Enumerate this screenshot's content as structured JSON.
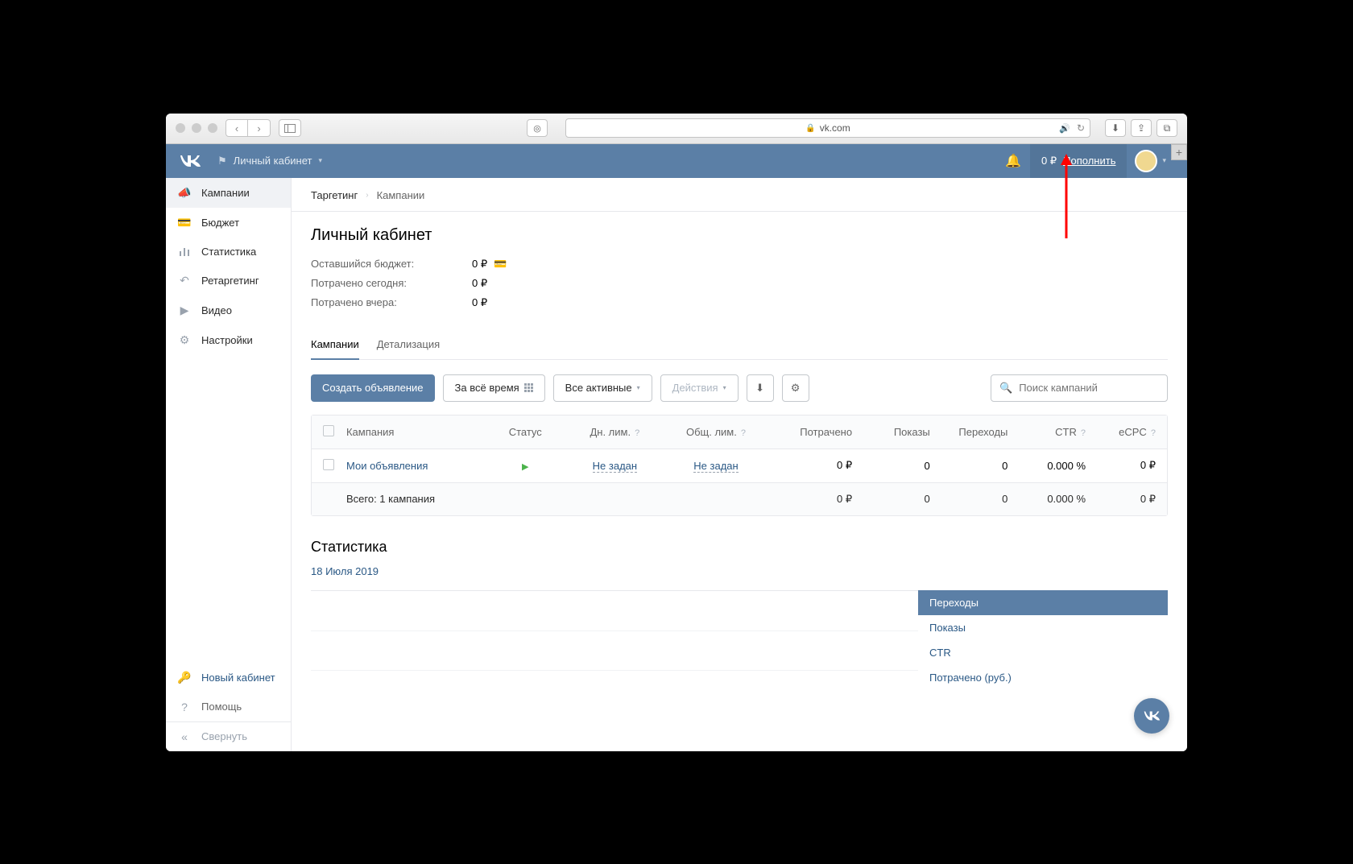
{
  "safari": {
    "url": "vk.com"
  },
  "header": {
    "cabinet": "Личный кабинет",
    "balance": "0 ₽",
    "topup": "Пополнить"
  },
  "sidebar": {
    "items": [
      {
        "label": "Кампании"
      },
      {
        "label": "Бюджет"
      },
      {
        "label": "Статистика"
      },
      {
        "label": "Ретаргетинг"
      },
      {
        "label": "Видео"
      },
      {
        "label": "Настройки"
      }
    ],
    "new_cabinet": "Новый кабинет",
    "help": "Помощь",
    "collapse": "Свернуть"
  },
  "breadcrumb": {
    "root": "Таргетинг",
    "current": "Кампании"
  },
  "page": {
    "title": "Личный кабинет",
    "budget": {
      "remaining_label": "Оставшийся бюджет:",
      "remaining_value": "0 ₽",
      "spent_today_label": "Потрачено сегодня:",
      "spent_today_value": "0 ₽",
      "spent_yesterday_label": "Потрачено вчера:",
      "spent_yesterday_value": "0 ₽"
    },
    "tabs": {
      "campaigns": "Кампании",
      "details": "Детализация"
    },
    "toolbar": {
      "create": "Создать объявление",
      "period": "За всё время",
      "filter": "Все активные",
      "actions": "Действия",
      "search_placeholder": "Поиск кампаний"
    },
    "table": {
      "headers": {
        "campaign": "Кампания",
        "status": "Статус",
        "daily_limit": "Дн. лим.",
        "total_limit": "Общ. лим.",
        "spent": "Потрачено",
        "impressions": "Показы",
        "clicks": "Переходы",
        "ctr": "CTR",
        "ecpc": "eCPC"
      },
      "rows": [
        {
          "name": "Мои объявления",
          "daily_limit": "Не задан",
          "total_limit": "Не задан",
          "spent": "0 ₽",
          "impressions": "0",
          "clicks": "0",
          "ctr": "0.000 %",
          "ecpc": "0 ₽"
        }
      ],
      "footer": {
        "label": "Всего: 1 кампания",
        "spent": "0 ₽",
        "impressions": "0",
        "clicks": "0",
        "ctr": "0.000 %",
        "ecpc": "0 ₽"
      }
    },
    "stats": {
      "title": "Статистика",
      "date": "18 Июля 2019",
      "legend": [
        "Переходы",
        "Показы",
        "CTR",
        "Потрачено (руб.)"
      ]
    }
  }
}
